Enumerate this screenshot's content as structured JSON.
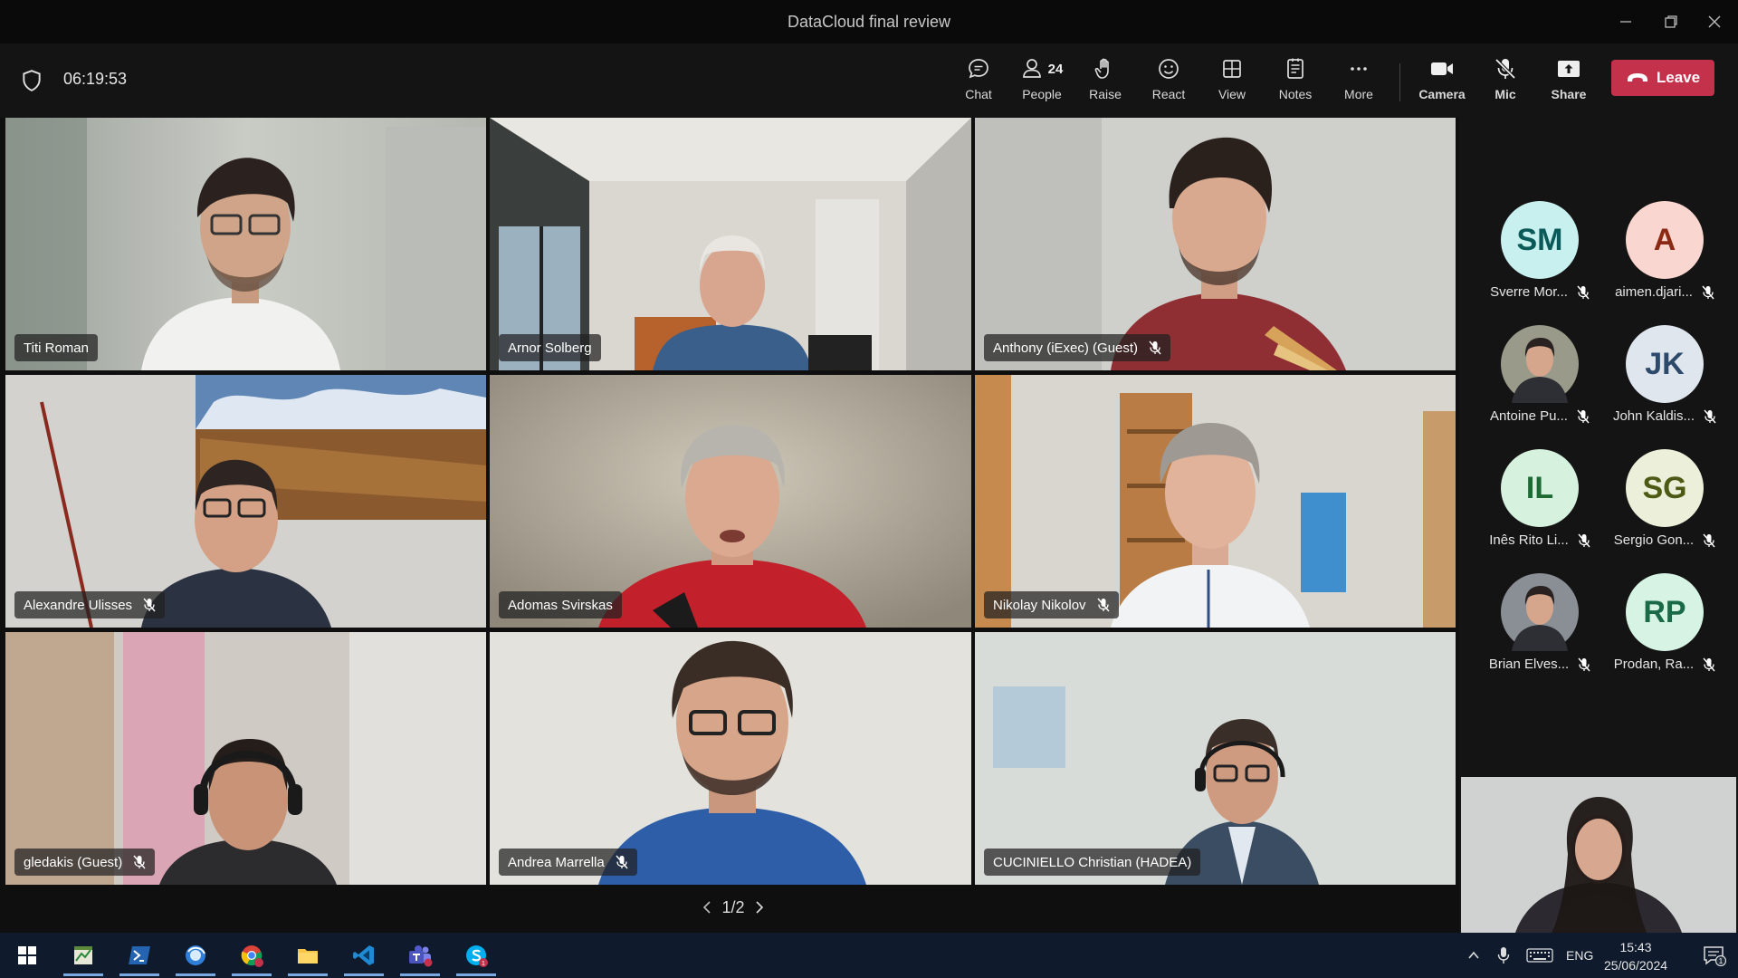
{
  "window": {
    "title": "DataCloud final review"
  },
  "toolbar": {
    "timer": "06:19:53",
    "people_count": "24",
    "buttons": {
      "chat": "Chat",
      "people": "People",
      "raise": "Raise",
      "react": "React",
      "view": "View",
      "notes": "Notes",
      "more": "More",
      "camera": "Camera",
      "mic": "Mic",
      "share": "Share",
      "leave": "Leave"
    }
  },
  "grid": {
    "pager": "1/2",
    "tiles": [
      {
        "name": "Titi Roman",
        "muted": false,
        "active": false
      },
      {
        "name": "Arnor Solberg",
        "muted": false,
        "active": false
      },
      {
        "name": "Anthony (iExec) (Guest)",
        "muted": true,
        "active": false
      },
      {
        "name": "Alexandre Ulisses",
        "muted": true,
        "active": false
      },
      {
        "name": "Adomas Svirskas",
        "muted": false,
        "active": true
      },
      {
        "name": "Nikolay Nikolov",
        "muted": true,
        "active": false
      },
      {
        "name": "gledakis (Guest)",
        "muted": true,
        "active": false
      },
      {
        "name": "Andrea Marrella",
        "muted": true,
        "active": false
      },
      {
        "name": "CUCINIELLO Christian (HADEA)",
        "muted": false,
        "active": false
      }
    ]
  },
  "participants": [
    {
      "initials": "SM",
      "name": "Sverre Mor...",
      "color": "#c7f0ef",
      "text_color": "#0b5a5a",
      "photo": false
    },
    {
      "initials": "A",
      "name": "aimen.djari...",
      "color": "#f9d6cf",
      "text_color": "#8a2a14",
      "photo": false
    },
    {
      "initials": "",
      "name": "Antoine Pu...",
      "color": "#9a9a8a",
      "text_color": "#ffffff",
      "photo": true
    },
    {
      "initials": "JK",
      "name": "John Kaldis...",
      "color": "#dfe6ee",
      "text_color": "#2d4a6a",
      "photo": false
    },
    {
      "initials": "IL",
      "name": "Inês Rito Li...",
      "color": "#d6f1de",
      "text_color": "#1d6a35",
      "photo": false
    },
    {
      "initials": "SG",
      "name": "Sergio Gon...",
      "color": "#ecefd9",
      "text_color": "#4d5a16",
      "photo": false
    },
    {
      "initials": "",
      "name": "Brian Elves...",
      "color": "#8a8f95",
      "text_color": "#ffffff",
      "photo": true
    },
    {
      "initials": "RP",
      "name": "Prodan, Ra...",
      "color": "#d6f3e4",
      "text_color": "#1a6a48",
      "photo": false
    }
  ],
  "taskbar": {
    "language": "ENG",
    "time": "15:43",
    "date": "25/06/2024",
    "notification_count": "1",
    "apps": [
      "start",
      "sheet-app",
      "powershell",
      "browser-blue",
      "chrome",
      "file-explorer",
      "vscode",
      "teams",
      "skype"
    ]
  }
}
